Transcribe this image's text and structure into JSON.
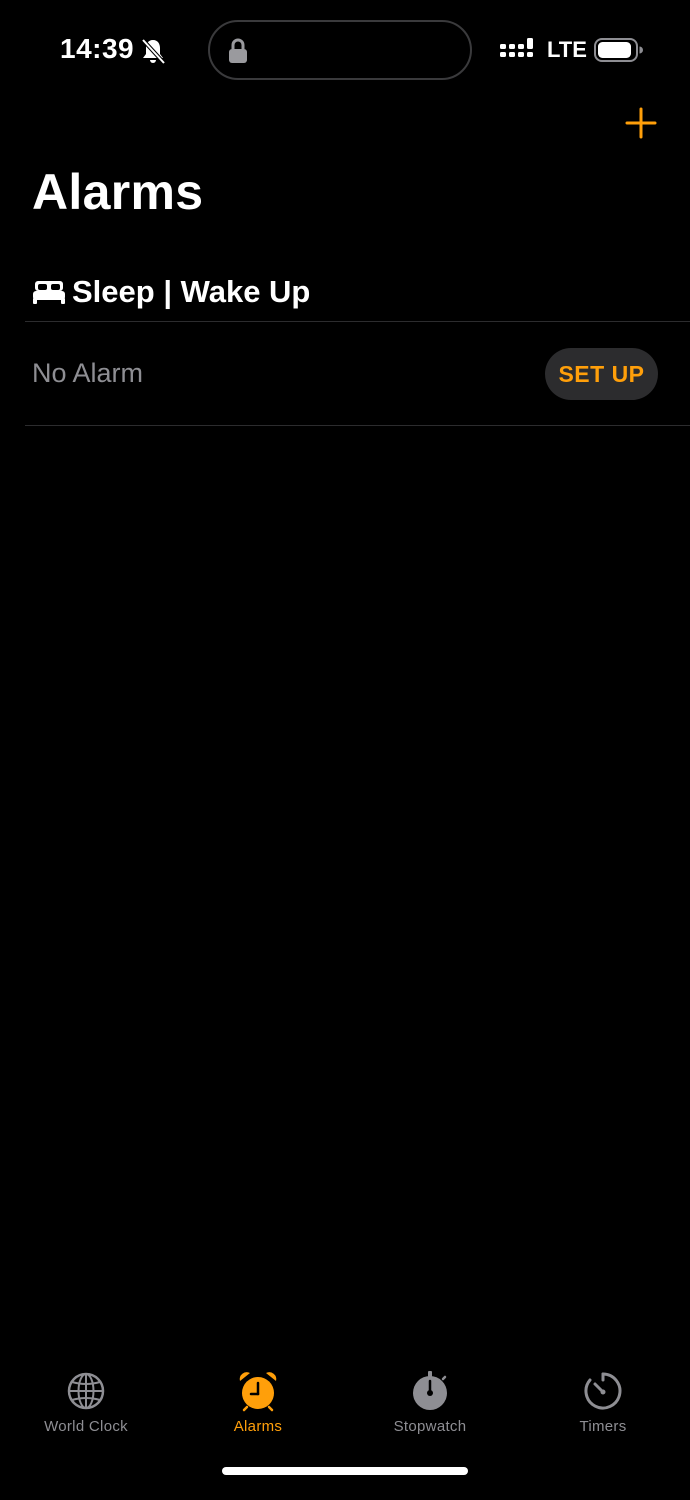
{
  "status_bar": {
    "time": "14:39",
    "network": "LTE",
    "icons": [
      "bell-slash-icon",
      "lock-icon",
      "signal-icon",
      "battery-icon"
    ]
  },
  "header": {
    "title": "Alarms",
    "add_icon": "plus-icon"
  },
  "sleep_section": {
    "label": "Sleep | Wake Up",
    "icon": "bed-icon",
    "no_alarm_label": "No Alarm",
    "setup_label": "SET UP"
  },
  "tabs": [
    {
      "label": "World Clock",
      "icon": "globe-icon",
      "active": false
    },
    {
      "label": "Alarms",
      "icon": "alarm-clock-icon",
      "active": true
    },
    {
      "label": "Stopwatch",
      "icon": "stopwatch-icon",
      "active": false
    },
    {
      "label": "Timers",
      "icon": "timer-icon",
      "active": false
    }
  ],
  "colors": {
    "accent": "#ff9f0a",
    "background": "#000000",
    "secondary_text": "#8e8e93",
    "button_background": "#2c2c2e"
  }
}
